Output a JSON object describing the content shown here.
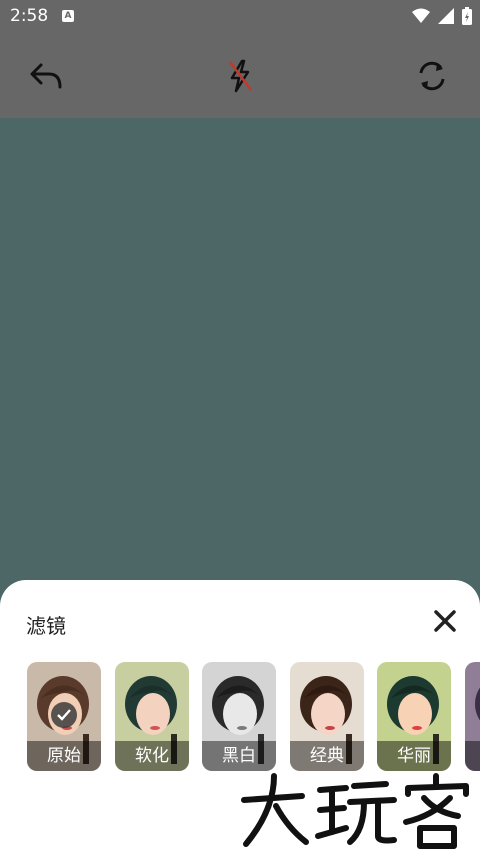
{
  "status_bar": {
    "time": "2:58",
    "notification_icon": "a-icon"
  },
  "toolbar": {
    "icons": [
      "undo-icon",
      "flash-off-icon",
      "switch-camera-icon"
    ]
  },
  "filter_panel": {
    "title": "滤镜",
    "close_icon": "close-icon",
    "filters": [
      {
        "label": "原始",
        "selected": true
      },
      {
        "label": "软化",
        "selected": false
      },
      {
        "label": "黑白",
        "selected": false
      },
      {
        "label": "经典",
        "selected": false
      },
      {
        "label": "华丽",
        "selected": false
      }
    ]
  },
  "watermark": "大玩客",
  "colors": {
    "preview": "#4c6766",
    "bars": "#676767",
    "sheet": "#ffffff"
  }
}
